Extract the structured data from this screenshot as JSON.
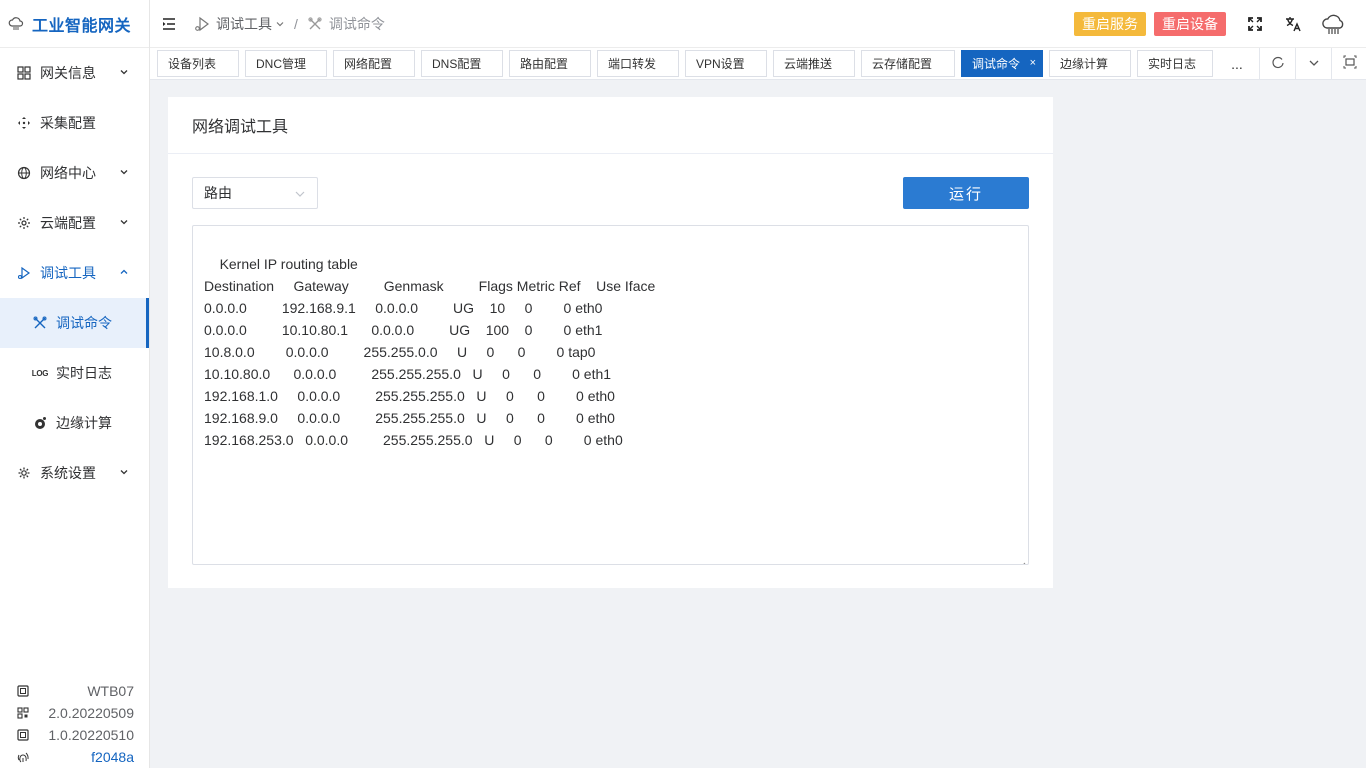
{
  "brand": {
    "title": "工业智能网关"
  },
  "sidebar": {
    "items": [
      {
        "label": "网关信息",
        "icon": "grid-icon"
      },
      {
        "label": "采集配置",
        "icon": "move-icon"
      },
      {
        "label": "网络中心",
        "icon": "globe-icon"
      },
      {
        "label": "云端配置",
        "icon": "settings-icon"
      },
      {
        "label": "调试工具",
        "icon": "debug-icon"
      },
      {
        "label": "调试命令",
        "icon": "tools-icon"
      },
      {
        "label": "实时日志",
        "icon": "log-icon"
      },
      {
        "label": "边缘计算",
        "icon": "edge-icon"
      },
      {
        "label": "系统设置",
        "icon": "gear-icon"
      }
    ],
    "log_icon_text": "LOG"
  },
  "sysinfo": {
    "model": "WTB07",
    "version1": "2.0.20220509",
    "version2": "1.0.20220510",
    "hash": "f2048a"
  },
  "header": {
    "crumb_parent": "调试工具",
    "crumb_sep": "/",
    "crumb_current": "调试命令",
    "restart_service": "重启服务",
    "restart_device": "重启设备"
  },
  "tags": {
    "items": [
      "设备列表",
      "DNC管理",
      "网络配置",
      "DNS配置",
      "路由配置",
      "端口转发",
      "VPN设置",
      "云端推送",
      "云存储配置",
      "调试命令",
      "边缘计算",
      "实时日志"
    ],
    "close": "×",
    "more": "..."
  },
  "card": {
    "title": "网络调试工具",
    "select_value": "路由",
    "run_label": "运行",
    "output": "Kernel IP routing table\nDestination     Gateway         Genmask         Flags Metric Ref    Use Iface\n0.0.0.0         192.168.9.1     0.0.0.0         UG    10     0        0 eth0\n0.0.0.0         10.10.80.1      0.0.0.0         UG    100    0        0 eth1\n10.8.0.0        0.0.0.0         255.255.0.0     U     0      0        0 tap0\n10.10.80.0      0.0.0.0         255.255.255.0   U     0      0        0 eth1\n192.168.1.0     0.0.0.0         255.255.255.0   U     0      0        0 eth0\n192.168.9.0     0.0.0.0         255.255.255.0   U     0      0        0 eth0\n192.168.253.0   0.0.0.0         255.255.255.0   U     0      0        0 eth0"
  },
  "colors": {
    "primary": "#1565c0",
    "warn": "#f4b93b",
    "danger": "#f56c6c"
  }
}
